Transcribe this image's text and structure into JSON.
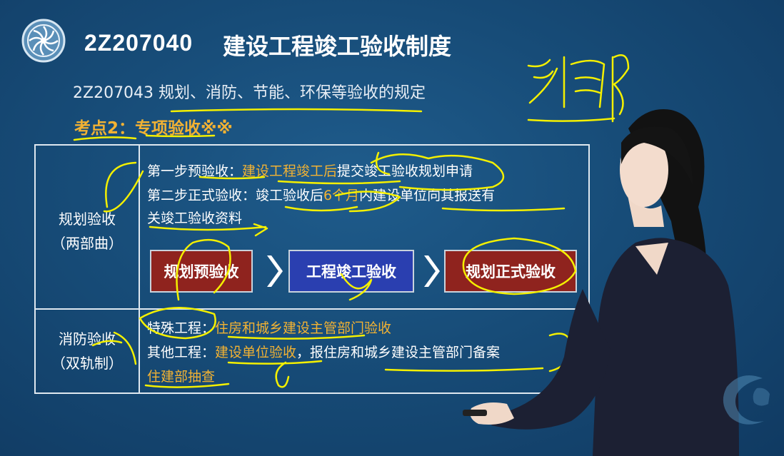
{
  "header": {
    "code": "2Z207040",
    "title": "建设工程竣工验收制度",
    "subtitle": "2Z207043  规划、消防、节能、环保等验收的规定",
    "kaodian": "考点2：专项验收※※"
  },
  "table": {
    "row1": {
      "head_line1": "规划验收",
      "head_line2": "（两部曲）",
      "line1_a": "第一步预验收：",
      "line1_b": "建设工程竣工后",
      "line1_c": "提交竣工验收规划申请",
      "line2_a": "第二步正式验收：",
      "line2_b": "竣工验收后",
      "line2_c": "6个月",
      "line2_d": "内建设单位向其报送有",
      "line3": "关竣工验收资料",
      "steps": [
        "规划预验收",
        "工程竣工验收",
        "规划正式验收"
      ]
    },
    "row2": {
      "head_line1": "消防验收",
      "head_line2": "（双轨制）",
      "line1_a": "特殊工程：",
      "line1_b": "住房和城乡建设主管部门验收",
      "line2_a": "其他工程：",
      "line2_b": "建设单位验收",
      "line2_c": "，报住房和城乡建设主管部门备案",
      "line3_b": "住建部抽查"
    }
  },
  "handwriting": {
    "note": "消防"
  },
  "colors": {
    "background": "#174c78",
    "accent_orange": "#f2b233",
    "step_red": "#8f231e",
    "step_blue": "#2a3fb0",
    "ink": "#f4f000"
  }
}
